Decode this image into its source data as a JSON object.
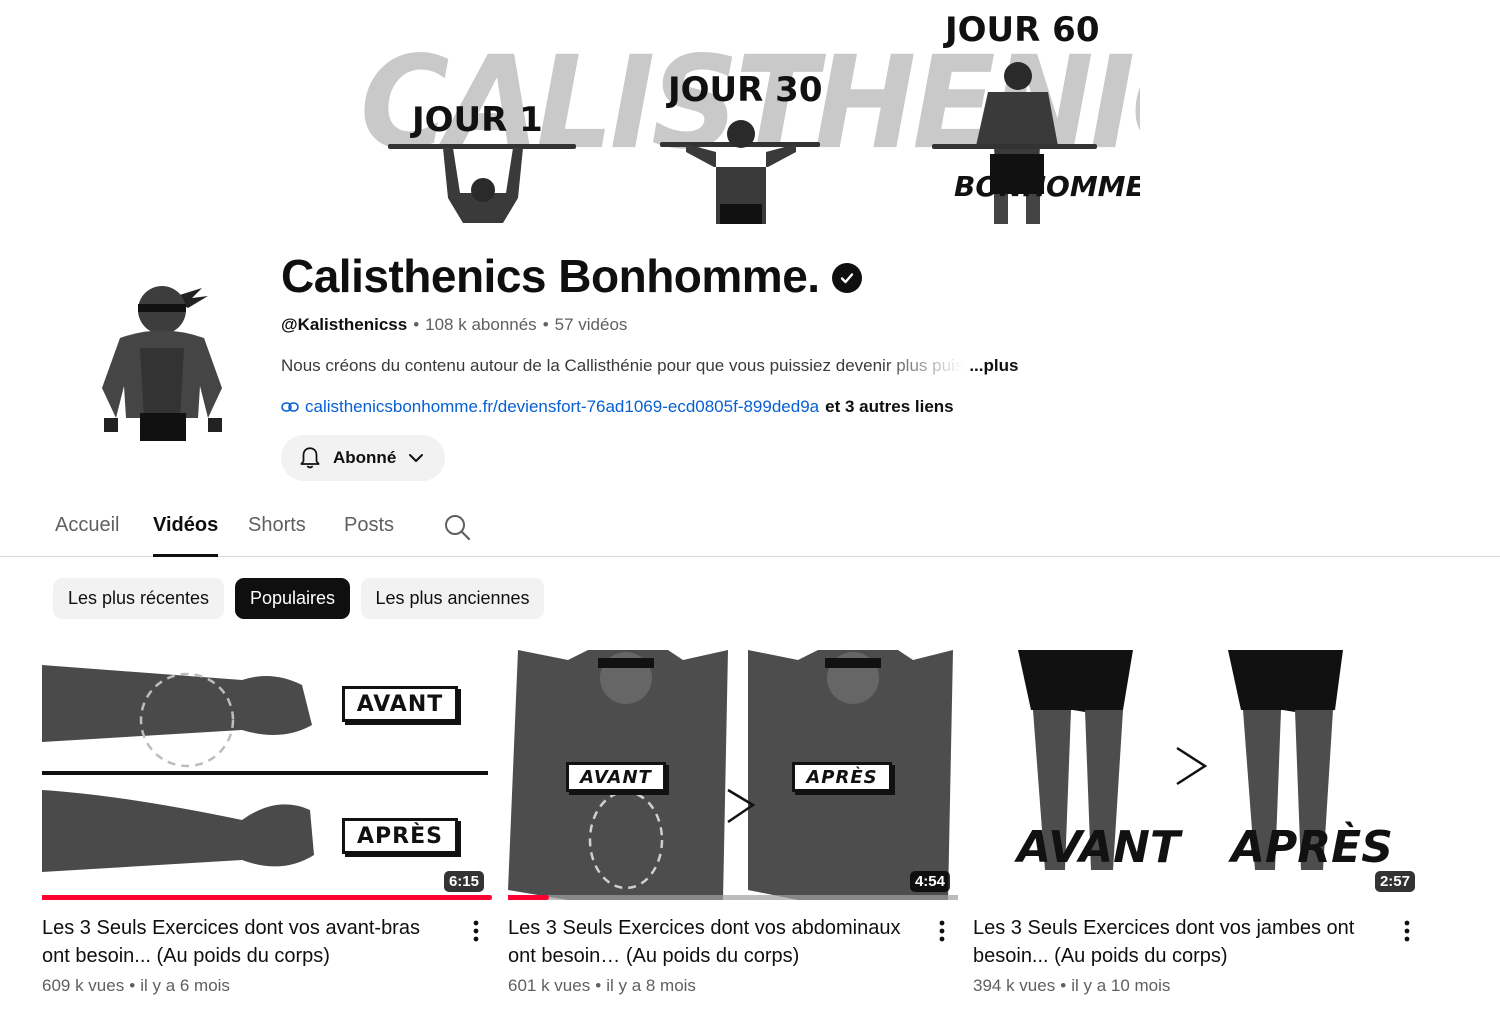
{
  "banner": {
    "background_word": "CALISTHENICS",
    "label_day1": "JOUR 1",
    "label_day30": "JOUR 30",
    "label_day60": "JOUR 60",
    "brand_mark": "BONHOMME."
  },
  "channel": {
    "name": "Calisthenics Bonhomme.",
    "handle": "@Kalisthenicss",
    "subscribers": "108 k abonnés",
    "videos_count": "57 vidéos",
    "description": "Nous créons du contenu autour de la Callisthénie pour que vous puissiez devenir plus puis",
    "more_label": "...plus",
    "link": "calisthenicsbonhomme.fr/deviensfort-76ad1069-ecd0805f-899ded9a",
    "other_links": "et 3 autres liens",
    "subscribe_label": "Abonné"
  },
  "tabs": [
    {
      "label": "Accueil",
      "active": false
    },
    {
      "label": "Vidéos",
      "active": true
    },
    {
      "label": "Shorts",
      "active": false
    },
    {
      "label": "Posts",
      "active": false
    }
  ],
  "chips": [
    {
      "label": "Les plus récentes",
      "selected": false
    },
    {
      "label": "Populaires",
      "selected": true
    },
    {
      "label": "Les plus anciennes",
      "selected": false
    }
  ],
  "videos": [
    {
      "title": "Les 3 Seuls Exercices dont vos avant-bras ont besoin... (Au poids du corps)",
      "views": "609 k vues",
      "age": "il y a 6 mois",
      "duration": "6:15",
      "watched_fraction": 1.0,
      "thumb_label_before": "AVANT",
      "thumb_label_after": "APRÈS"
    },
    {
      "title": "Les 3 Seuls Exercices dont vos abdominaux ont besoin… (Au poids du corps)",
      "views": "601 k vues",
      "age": "il y a 8 mois",
      "duration": "4:54",
      "watched_fraction": 0.09,
      "thumb_label_before": "AVANT",
      "thumb_label_after": "APRÈS"
    },
    {
      "title": "Les 3 Seuls Exercices dont vos jambes ont besoin... (Au poids du corps)",
      "views": "394 k vues",
      "age": "il y a 10 mois",
      "duration": "2:57",
      "watched_fraction": 0,
      "thumb_label_before": "AVANT",
      "thumb_label_after": "APRÈS"
    }
  ],
  "colors": {
    "accent_red": "#ff0033",
    "link_blue": "#065fd4",
    "chip_bg": "#f2f2f2",
    "text_secondary": "#606060"
  }
}
